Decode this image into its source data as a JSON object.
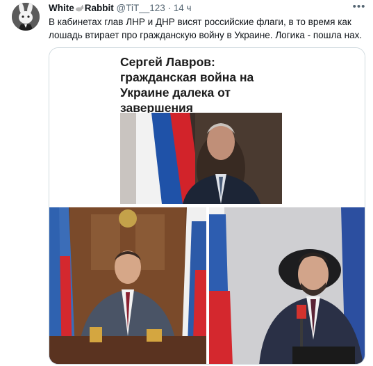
{
  "tweet": {
    "display_name_part1": "White",
    "display_name_part2": "Rabbit",
    "handle_meta": "@TiT__123 · 14 ч",
    "text": "В кабинетах глав ЛНР и ДНР висят российские флаги, в то время как лошадь втирает про гражданскую войну в Украине. Логика - пошла нах."
  },
  "media": {
    "headline": "Сергей Лавров: гражданская война на Украине далека от завершения"
  },
  "icons": {
    "more": "more-icon",
    "avatar": "rabbit-avatar",
    "emoji": "rabbit-emoji"
  }
}
